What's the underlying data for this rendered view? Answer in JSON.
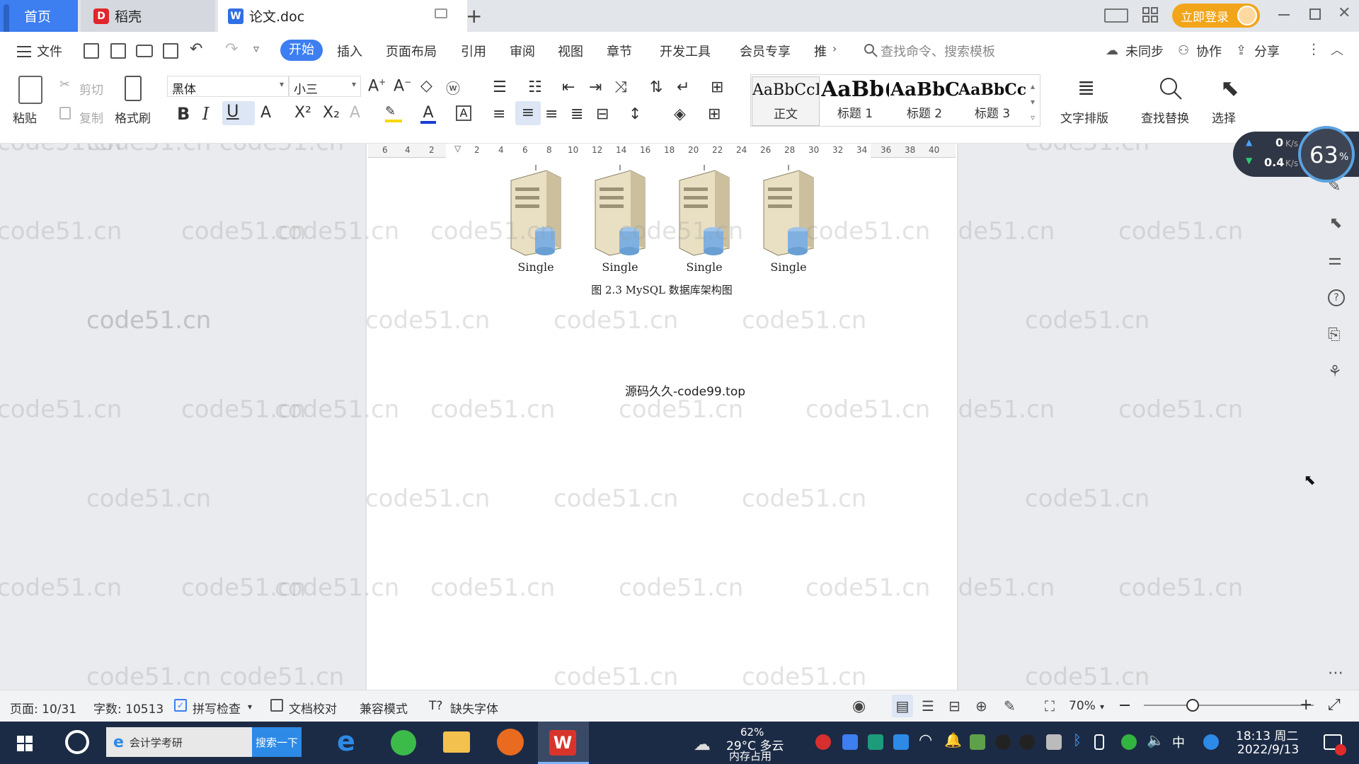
{
  "tabs": {
    "home": "首页",
    "daoke": "稻壳",
    "doc": "论文.doc"
  },
  "titlebar": {
    "login": "立即登录"
  },
  "menu": {
    "file": "文件",
    "items": [
      "开始",
      "插入",
      "页面布局",
      "引用",
      "审阅",
      "视图",
      "章节",
      "开发工具",
      "会员专享",
      "推"
    ],
    "search_cmd": "查找命令、搜索模板",
    "sync": "未同步",
    "collab": "协作",
    "share": "分享"
  },
  "ribbon": {
    "paste": "粘贴",
    "cut": "剪切",
    "copy": "复制",
    "format_painter": "格式刷",
    "font_name": "黑体",
    "font_size": "小三",
    "styles": [
      {
        "preview": "AaBbCcI",
        "name": "正文"
      },
      {
        "preview": "AaBb(",
        "name": "标题 1"
      },
      {
        "preview": "AaBbC",
        "name": "标题 2"
      },
      {
        "preview": "AaBbCcl",
        "name": "标题 3"
      }
    ],
    "text_layout": "文字排版",
    "find_replace": "查找替换",
    "select": "选择"
  },
  "ruler": {
    "ticks": [
      "6",
      "4",
      "2",
      "2",
      "4",
      "6",
      "8",
      "10",
      "12",
      "14",
      "16",
      "18",
      "20",
      "22",
      "24",
      "26",
      "28",
      "30",
      "32",
      "34",
      "36",
      "38",
      "40"
    ]
  },
  "network": {
    "up": "0",
    "up_unit": "K/s",
    "down": "0.4",
    "down_unit": "K/s",
    "percent": "63",
    "percent_unit": "%"
  },
  "document": {
    "servers": [
      "Single",
      "Single",
      "Single",
      "Single"
    ],
    "caption": "图 2.3 MySQL 数据库架构图",
    "watermark_line": "源码久久-code99.top",
    "watermark": "code51.cn"
  },
  "status": {
    "page": "页面: 10/31",
    "words": "字数: 10513",
    "spell": "拼写检查",
    "proof": "文档校对",
    "compat": "兼容模式",
    "missing_font": "缺失字体",
    "zoom": "70%"
  },
  "taskbar": {
    "search_text": "会计学考研",
    "search_btn": "搜索一下",
    "weather_pct": "62%",
    "weather_temp": "29°C 多云",
    "mem": "内存占用",
    "ime": "中",
    "time": "18:13 周二",
    "date": "2022/9/13"
  },
  "colors": {
    "accent": "#3d7ef0",
    "login": "#f2a51a",
    "taskbar": "#1c2b45"
  }
}
